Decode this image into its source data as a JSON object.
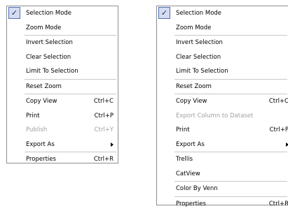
{
  "menus": [
    {
      "items": [
        {
          "label": "Selection Mode",
          "shortcut": "",
          "checked": true
        },
        {
          "label": "Zoom Mode",
          "shortcut": ""
        },
        {
          "separator": true
        },
        {
          "label": "Invert Selection",
          "shortcut": ""
        },
        {
          "label": "Clear Selection",
          "shortcut": ""
        },
        {
          "label": "Limit To Selection",
          "shortcut": ""
        },
        {
          "separator": true
        },
        {
          "label": "Reset Zoom",
          "shortcut": ""
        },
        {
          "separator": true
        },
        {
          "label": "Copy View",
          "shortcut": "Ctrl+C"
        },
        {
          "label": "Print",
          "shortcut": "Ctrl+P"
        },
        {
          "label": "Publish",
          "shortcut": "Ctrl+Y",
          "disabled": true
        },
        {
          "label": "Export As",
          "shortcut": "",
          "submenu": true
        },
        {
          "separator": true
        },
        {
          "label": "Properties",
          "shortcut": "Ctrl+R"
        }
      ]
    },
    {
      "items": [
        {
          "label": "Selection Mode",
          "shortcut": "",
          "checked": true
        },
        {
          "label": "Zoom Mode",
          "shortcut": ""
        },
        {
          "separator": true
        },
        {
          "label": "Invert Selection",
          "shortcut": ""
        },
        {
          "label": "Clear Selection",
          "shortcut": ""
        },
        {
          "label": "Limit To Selection",
          "shortcut": ""
        },
        {
          "separator": true
        },
        {
          "label": "Reset Zoom",
          "shortcut": ""
        },
        {
          "separator": true
        },
        {
          "label": "Copy View",
          "shortcut": "Ctrl+C"
        },
        {
          "label": "Export Column to Dataset",
          "shortcut": "",
          "disabled": true
        },
        {
          "label": "Print",
          "shortcut": "Ctrl+P"
        },
        {
          "label": "Export As",
          "shortcut": "",
          "submenu": true
        },
        {
          "separator": true
        },
        {
          "label": "Trellis",
          "shortcut": ""
        },
        {
          "label": "CatView",
          "shortcut": ""
        },
        {
          "separator": true
        },
        {
          "label": "Color By Venn",
          "shortcut": ""
        },
        {
          "separator": true
        },
        {
          "label": "Properties",
          "shortcut": "Ctrl+R"
        }
      ]
    }
  ],
  "icons": {
    "check": "checkmark-icon",
    "submenu": "submenu-arrow-icon"
  },
  "colors": {
    "check_bg": "#d4dcef",
    "check_border": "#4f6fb6",
    "disabled_text": "#a0a0a0"
  }
}
